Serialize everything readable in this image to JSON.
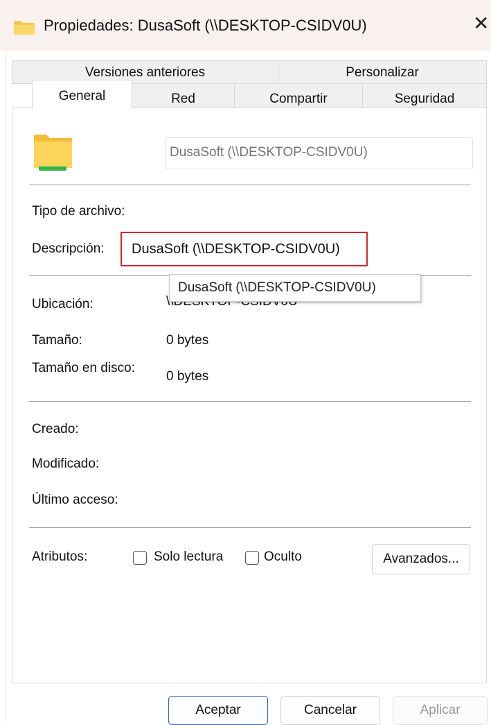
{
  "window": {
    "title": "Propiedades: DusaSoft (\\\\DESKTOP-CSIDV0U)",
    "close_glyph": "✕"
  },
  "tabs": {
    "row1": [
      "Versiones anteriores",
      "Personalizar"
    ],
    "row2": [
      "General",
      "Red",
      "Compartir",
      "Seguridad"
    ],
    "active": "General"
  },
  "general": {
    "name_value": "DusaSoft (\\\\DESKTOP-CSIDV0U)",
    "tipo_label": "Tipo de archivo:",
    "descripcion_label": "Descripción:",
    "descripcion_value": "DusaSoft (\\\\DESKTOP-CSIDV0U)",
    "tooltip": "DusaSoft (\\\\DESKTOP-CSIDV0U)",
    "ubicacion_label": "Ubicación:",
    "ubicacion_value": "\\\\DESKTOP-CSIDV0U",
    "tamano_label": "Tamaño:",
    "tamano_value": "0 bytes",
    "tamano_disco_label": "Tamaño en disco:",
    "tamano_disco_value": "0 bytes",
    "creado_label": "Creado:",
    "modificado_label": "Modificado:",
    "ultimo_acceso_label": "Último acceso:",
    "atributos_label": "Atributos:",
    "solo_lectura_label": "Solo lectura",
    "oculto_label": "Oculto",
    "avanzados_label": "Avanzados..."
  },
  "buttons": {
    "aceptar": "Aceptar",
    "cancelar": "Cancelar",
    "aplicar": "Aplicar"
  },
  "colors": {
    "folder": "#f5c84c",
    "network_bar": "#3cb043",
    "highlight_border": "#d8232f"
  }
}
